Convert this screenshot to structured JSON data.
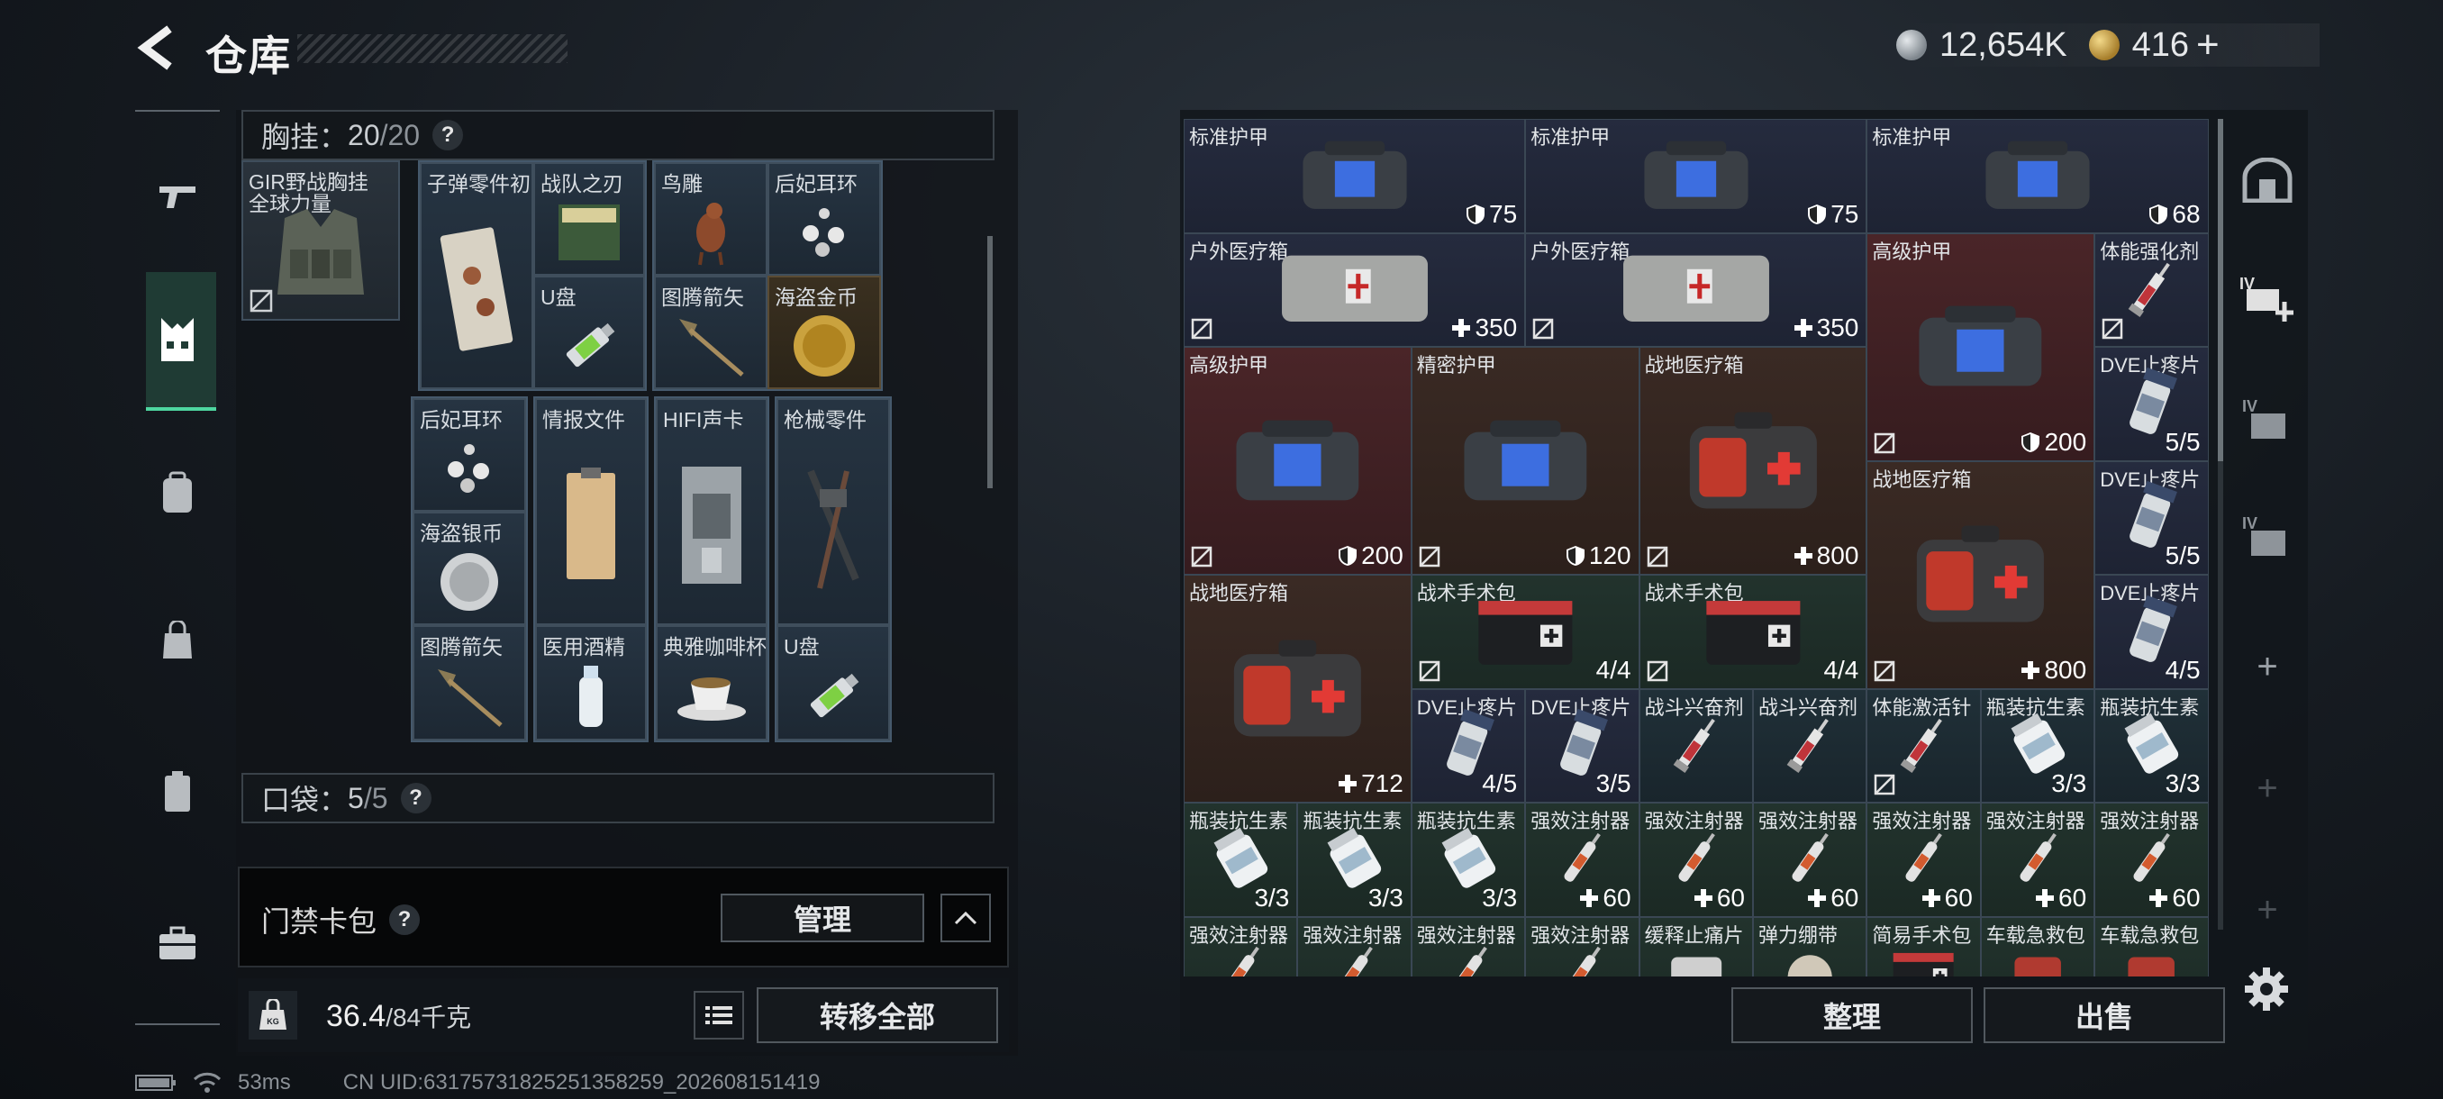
{
  "header": {
    "title": "仓库",
    "currency": [
      {
        "icon": "silver-coin-icon",
        "value": "12,654K",
        "color": "#9aa3ab"
      },
      {
        "icon": "gold-triangle-icon",
        "value": "416",
        "color": "#caa64a"
      }
    ],
    "plus": "+"
  },
  "nav": {
    "items": [
      "gun-icon",
      "vest-icon",
      "backpack-icon",
      "bag-icon",
      "case-icon",
      "briefcase-icon"
    ],
    "active": "vest-icon"
  },
  "left": {
    "vest_label": "胸挂：",
    "vest_count": "20",
    "vest_cap": "/20",
    "help": "?",
    "vest_item": "GIR野战胸挂",
    "vest_item2": "全球力量",
    "cells": [
      {
        "name": "子弹零件初",
        "icon": "ammo-parts-icon"
      },
      {
        "name": "战队之刃",
        "icon": "dvd-icon"
      },
      {
        "name": "U盘",
        "icon": "usb-icon"
      },
      {
        "name": "鸟雕",
        "icon": "bird-statue-icon"
      },
      {
        "name": "后妃耳环",
        "icon": "earring-icon"
      },
      {
        "name": "图腾箭矢",
        "icon": "arrow-icon"
      },
      {
        "name": "海盗金币",
        "icon": "gold-coin-icon"
      },
      {
        "name": "后妃耳环",
        "icon": "earring-icon"
      },
      {
        "name": "海盗银币",
        "icon": "silver-coin-icon"
      },
      {
        "name": "图腾箭矢",
        "icon": "arrow-icon"
      },
      {
        "name": "情报文件",
        "icon": "clipboard-icon"
      },
      {
        "name": "医用酒精",
        "icon": "bottle-icon"
      },
      {
        "name": "HIFI声卡",
        "icon": "soundcard-icon"
      },
      {
        "name": "典雅咖啡杯",
        "icon": "coffee-cup-icon"
      },
      {
        "name": "枪械零件",
        "icon": "gun-parts-icon"
      },
      {
        "name": "U盘",
        "icon": "usb-icon"
      }
    ],
    "pocket_label": "口袋：",
    "pocket_count": "5",
    "pocket_cap": "/5",
    "card_pack": "门禁卡包",
    "manage": "管理",
    "weight": "36.4",
    "weight_cap": "/84千克",
    "transfer_all": "转移全部",
    "kg": "KG"
  },
  "status": {
    "ping": "53ms",
    "uid": "CN UID:63175731825251358259_202608151419"
  },
  "right": {
    "items": [
      {
        "name": "标准护甲",
        "val": "75",
        "kind": "shield",
        "icon": "armor-bag-icon",
        "color": "blue"
      },
      {
        "name": "标准护甲",
        "val": "75",
        "kind": "shield",
        "icon": "armor-bag-icon",
        "color": "blue"
      },
      {
        "name": "标准护甲",
        "val": "68",
        "kind": "shield",
        "icon": "armor-bag-icon",
        "color": "blue"
      },
      {
        "name": "户外医疗箱",
        "val": "350",
        "kind": "plus",
        "icon": "medkit-pouch-icon",
        "color": "blue",
        "lock": true
      },
      {
        "name": "户外医疗箱",
        "val": "350",
        "kind": "plus",
        "icon": "medkit-pouch-icon",
        "color": "blue",
        "lock": true
      },
      {
        "name": "高级护甲",
        "val": "200",
        "kind": "shield",
        "icon": "armor-bag-icon",
        "color": "red",
        "lock": true
      },
      {
        "name": "体能强化剂",
        "val": "",
        "kind": "",
        "icon": "syringe-icon",
        "color": "blue",
        "lock": true
      },
      {
        "name": "高级护甲",
        "val": "200",
        "kind": "shield",
        "icon": "armor-bag-icon",
        "color": "red",
        "lock": true
      },
      {
        "name": "精密护甲",
        "val": "120",
        "kind": "shield",
        "icon": "armor-bag-icon",
        "color": "brown",
        "lock": true
      },
      {
        "name": "战地医疗箱",
        "val": "800",
        "kind": "plus",
        "icon": "first-aid-case-icon",
        "color": "brown",
        "lock": true
      },
      {
        "name": "DVE止疼片",
        "val": "5/5",
        "kind": "",
        "icon": "pill-bottle-icon",
        "color": "blue"
      },
      {
        "name": "战地医疗箱",
        "val": "800",
        "kind": "plus",
        "icon": "first-aid-case-icon",
        "color": "brown",
        "lock": true
      },
      {
        "name": "DVE止疼片",
        "val": "5/5",
        "kind": "",
        "icon": "pill-bottle-icon",
        "color": "blue"
      },
      {
        "name": "战地医疗箱",
        "val": "712",
        "kind": "plus",
        "icon": "first-aid-case-icon",
        "color": "brown"
      },
      {
        "name": "战术手术包",
        "val": "4/4",
        "kind": "",
        "icon": "surgery-kit-icon",
        "color": "green",
        "lock": true
      },
      {
        "name": "战术手术包",
        "val": "4/4",
        "kind": "",
        "icon": "surgery-kit-icon",
        "color": "green",
        "lock": true
      },
      {
        "name": "DVE止疼片",
        "val": "4/5",
        "kind": "",
        "icon": "pill-bottle-icon",
        "color": "blue"
      },
      {
        "name": "DVE止疼片",
        "val": "4/5",
        "kind": "",
        "icon": "pill-bottle-icon",
        "color": "blue"
      },
      {
        "name": "DVE止疼片",
        "val": "3/5",
        "kind": "",
        "icon": "pill-bottle-icon",
        "color": "blue"
      },
      {
        "name": "战斗兴奋剂",
        "val": "",
        "kind": "",
        "icon": "syringe-icon",
        "color": "teal"
      },
      {
        "name": "战斗兴奋剂",
        "val": "",
        "kind": "",
        "icon": "syringe-icon",
        "color": "teal"
      },
      {
        "name": "体能激活针",
        "val": "",
        "kind": "",
        "icon": "syringe-icon",
        "color": "teal",
        "lock": true
      },
      {
        "name": "瓶装抗生素",
        "val": "3/3",
        "kind": "",
        "icon": "antibiotic-bottle-icon",
        "color": "teal"
      },
      {
        "name": "瓶装抗生素",
        "val": "3/3",
        "kind": "",
        "icon": "antibiotic-bottle-icon",
        "color": "teal"
      },
      {
        "name": "瓶装抗生素",
        "val": "3/3",
        "kind": "",
        "icon": "antibiotic-bottle-icon",
        "color": "green"
      },
      {
        "name": "瓶装抗生素",
        "val": "3/3",
        "kind": "",
        "icon": "antibiotic-bottle-icon",
        "color": "green"
      },
      {
        "name": "瓶装抗生素",
        "val": "3/3",
        "kind": "",
        "icon": "antibiotic-bottle-icon",
        "color": "green"
      },
      {
        "name": "强效注射器",
        "val": "60",
        "kind": "plus",
        "icon": "injector-icon",
        "color": "green"
      },
      {
        "name": "强效注射器",
        "val": "60",
        "kind": "plus",
        "icon": "injector-icon",
        "color": "green"
      },
      {
        "name": "强效注射器",
        "val": "60",
        "kind": "plus",
        "icon": "injector-icon",
        "color": "green"
      },
      {
        "name": "强效注射器",
        "val": "60",
        "kind": "plus",
        "icon": "injector-icon",
        "color": "green"
      },
      {
        "name": "强效注射器",
        "val": "60",
        "kind": "plus",
        "icon": "injector-icon",
        "color": "green"
      },
      {
        "name": "强效注射器",
        "val": "60",
        "kind": "plus",
        "icon": "injector-icon",
        "color": "green"
      },
      {
        "name": "强效注射器",
        "val": "",
        "kind": "",
        "icon": "injector-icon",
        "color": "green"
      },
      {
        "name": "强效注射器",
        "val": "",
        "kind": "",
        "icon": "injector-icon",
        "color": "green"
      },
      {
        "name": "强效注射器",
        "val": "",
        "kind": "",
        "icon": "injector-icon",
        "color": "green"
      },
      {
        "name": "强效注射器",
        "val": "",
        "kind": "",
        "icon": "injector-icon",
        "color": "green"
      },
      {
        "name": "缓释止痛片",
        "val": "",
        "kind": "",
        "icon": "pill-icon",
        "color": "green"
      },
      {
        "name": "弹力绷带",
        "val": "",
        "kind": "",
        "icon": "bandage-icon",
        "color": "green"
      },
      {
        "name": "简易手术包",
        "val": "",
        "kind": "",
        "icon": "surgery-kit-icon",
        "color": "green"
      },
      {
        "name": "车载急救包",
        "val": "",
        "kind": "",
        "icon": "first-aid-bag-icon",
        "color": "green"
      },
      {
        "name": "车载急救包",
        "val": "",
        "kind": "",
        "icon": "first-aid-bag-icon",
        "color": "green"
      }
    ],
    "sort": "整理",
    "sell": "出售"
  },
  "rail": [
    "safe-icon",
    "add-key-icon",
    "key-room-icon",
    "key-box-icon",
    "+",
    "+",
    "+"
  ]
}
